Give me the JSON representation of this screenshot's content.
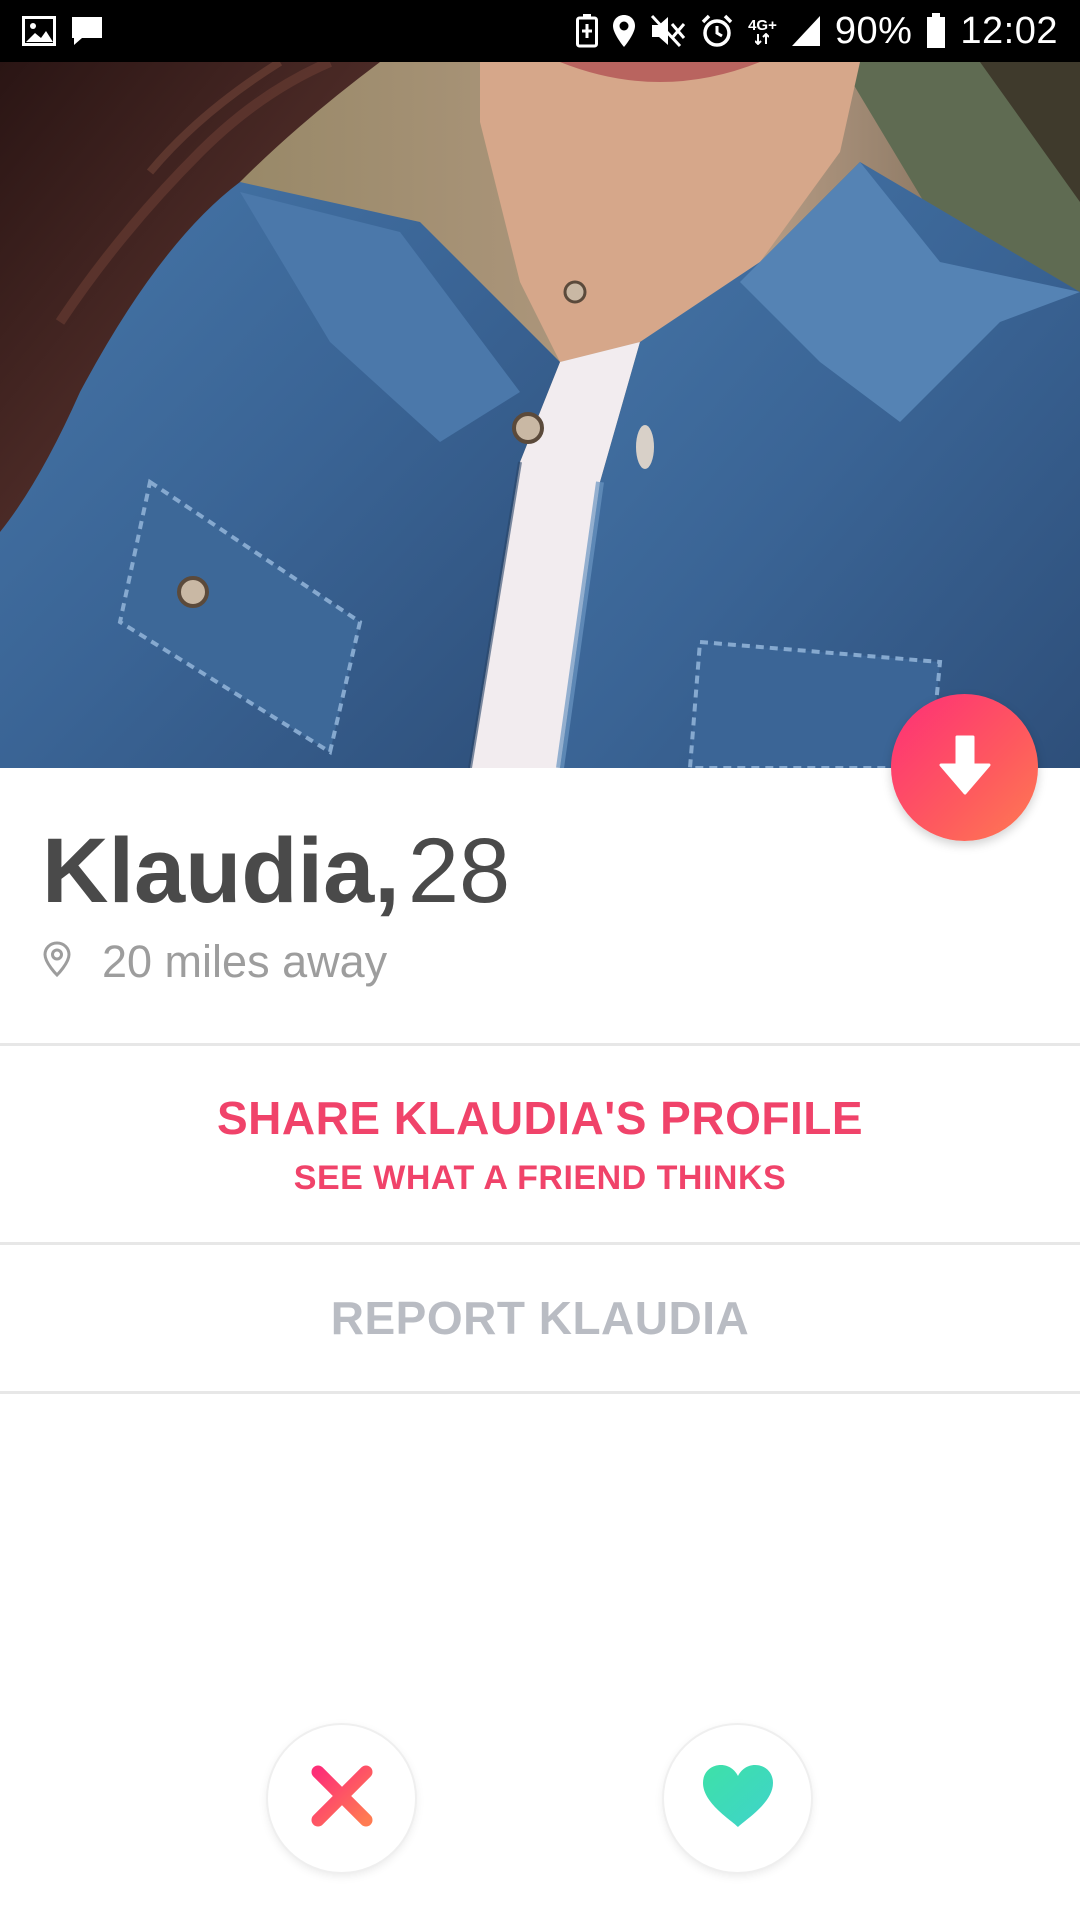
{
  "status_bar": {
    "battery_percent": "90%",
    "time": "12:02",
    "network_label": "4G+",
    "left_icons": [
      "gallery-icon",
      "message-icon"
    ],
    "right_icons": [
      "battery-saver-icon",
      "location-icon",
      "mute-icon",
      "alarm-icon",
      "network-4g-icon",
      "signal-icon",
      "battery-icon"
    ]
  },
  "profile": {
    "photo_description_icon": "profile-photo",
    "name": "Klaudia,",
    "age": "28",
    "distance": "20 miles away"
  },
  "share": {
    "title": "SHARE KLAUDIA'S PROFILE",
    "subtitle": "SEE WHAT A FRIEND THINKS"
  },
  "report": {
    "label": "REPORT KLAUDIA"
  },
  "actions": {
    "collapse": "arrow-down-icon",
    "nope": "close-x-icon",
    "like": "heart-icon"
  },
  "colors": {
    "accent": "#f0436a",
    "gradient_start": "#fd2f77",
    "gradient_end": "#ff7b52",
    "like": "#3fe0b6",
    "text_dark": "#4a4a4a",
    "text_muted": "#9d9d9d",
    "report_gray": "#b9bcc3"
  }
}
